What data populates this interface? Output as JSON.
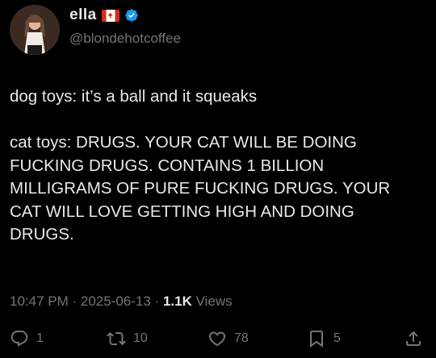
{
  "author": {
    "display_name": "ella",
    "handle": "@blondehotcoffee",
    "flag_icon": "canada-flag-icon",
    "verified_icon": "verified-badge-icon"
  },
  "post": {
    "text": "dog toys: it’s a ball and it squeaks\n\ncat toys: DRUGS. YOUR CAT WILL BE DOING\nFUCKING DRUGS. CONTAINS 1 BILLION\nMILLIGRAMS OF PURE FUCKING DRUGS. YOUR\nCAT WILL LOVE GETTING HIGH AND DOING\nDRUGS.",
    "time": "10:47 PM",
    "date": "2025-06-13",
    "separator": " · ",
    "views_count": "1.1K",
    "views_label": " Views"
  },
  "actions": {
    "replies": "1",
    "reposts": "10",
    "likes": "78",
    "bookmarks": "5"
  },
  "colors": {
    "background": "#000000",
    "text": "#e7e9ea",
    "secondary": "#71767b",
    "verified": "#1d9bf0"
  }
}
